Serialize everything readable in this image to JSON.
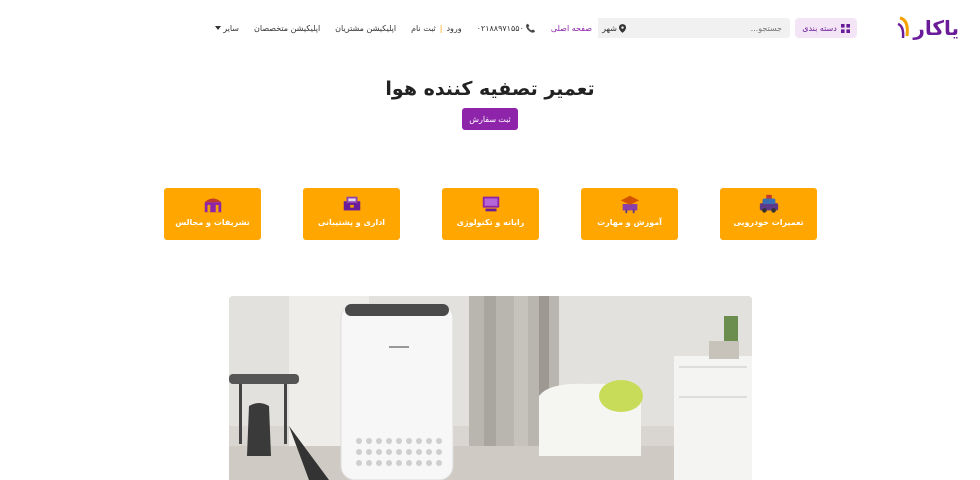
{
  "header": {
    "logo_text": "یاکار",
    "category_button": "دسته بندی",
    "search_placeholder": "جستجو...",
    "city_button": "شهر",
    "nav": [
      {
        "id": "home",
        "label": "صفحه اصلی"
      },
      {
        "id": "phone",
        "label": "۰۲۱۸۸۹۷۱۵۵۰"
      },
      {
        "id": "login",
        "label": "ورود",
        "label2": "ثبت نام"
      },
      {
        "id": "customer-app",
        "label": "اپلیکیشن مشتریان"
      },
      {
        "id": "expert-app",
        "label": "اپلیکیشن متخصصان"
      },
      {
        "id": "other",
        "label": "سایر"
      }
    ]
  },
  "hero": {
    "title": "تعمیر تصفیه کننده هوا",
    "order_button": "ثبت سفارش"
  },
  "categories": [
    {
      "label": "تعمیرات خودرویی",
      "icon": "car-repair-icon"
    },
    {
      "label": "آموزش و مهارت",
      "icon": "education-icon"
    },
    {
      "label": "رایانه و تکنولوژی",
      "icon": "computer-icon"
    },
    {
      "label": "اداری و پشتیبانی",
      "icon": "office-icon"
    },
    {
      "label": "تشریفات و مجالس",
      "icon": "ceremony-icon"
    }
  ],
  "colors": {
    "brand": "#8e24aa",
    "accent": "#ffa600",
    "category_tint": "#f3e5f5"
  }
}
